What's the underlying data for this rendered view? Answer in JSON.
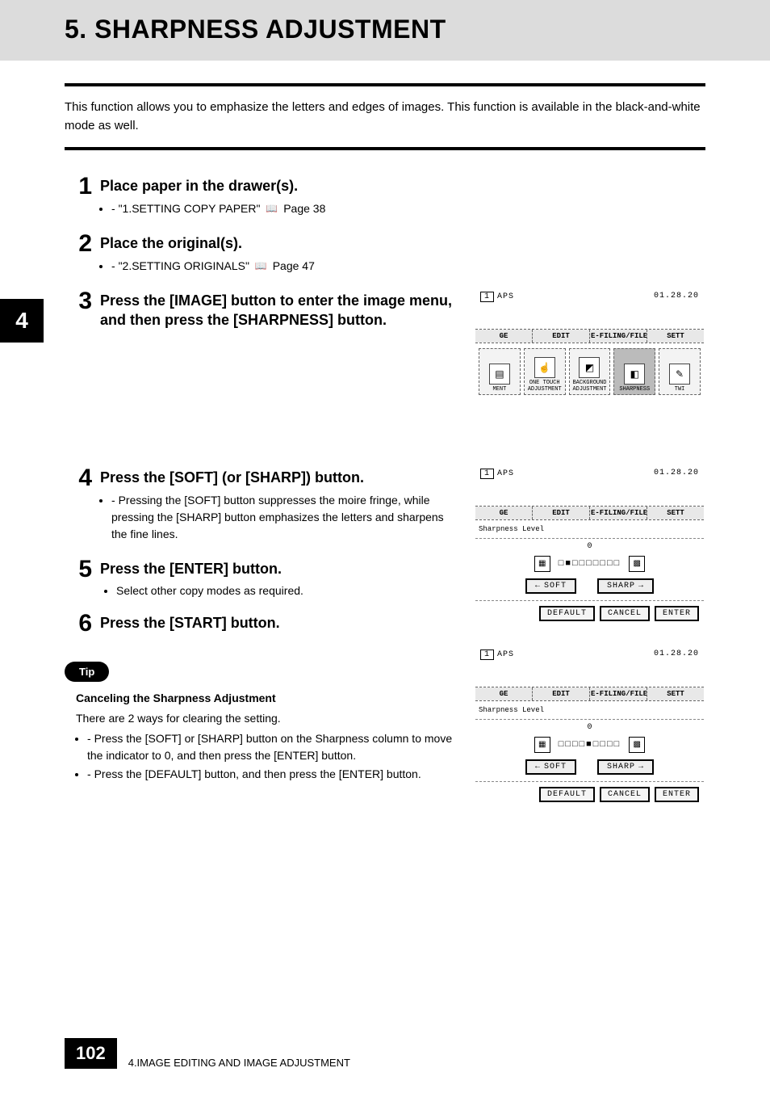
{
  "header": {
    "title": "5. SHARPNESS ADJUSTMENT"
  },
  "intro": "This function allows you to emphasize the letters and edges of images. This function is available in the black-and-white mode as well.",
  "side_tab": "4",
  "steps": {
    "s1": {
      "num": "1",
      "title": "Place paper in the drawer(s).",
      "ref": "\"1.SETTING COPY PAPER\"",
      "page": "Page 38"
    },
    "s2": {
      "num": "2",
      "title": "Place the original(s).",
      "ref": "\"2.SETTING ORIGINALS\"",
      "page": "Page 47"
    },
    "s3": {
      "num": "3",
      "title": "Press the [IMAGE] button to enter the image menu, and then press the [SHARPNESS] button."
    },
    "s4": {
      "num": "4",
      "title": "Press the [SOFT] (or [SHARP]) button.",
      "note": "Pressing the [SOFT] button suppresses the moire fringe, while pressing the [SHARP] button emphasizes the letters and sharpens the fine lines."
    },
    "s5": {
      "num": "5",
      "title": "Press the [ENTER] button.",
      "bullet": "Select other copy modes as required."
    },
    "s6": {
      "num": "6",
      "title": "Press the [START] button."
    }
  },
  "tip": {
    "badge": "Tip",
    "title": "Canceling the Sharpness Adjustment",
    "lead": "There are 2 ways for clearing the setting.",
    "items": [
      "Press the [SOFT] or [SHARP] button on the Sharpness column to move the indicator to 0, and then press the [ENTER] button.",
      "Press the [DEFAULT] button, and then press the [ENTER] button."
    ]
  },
  "panels": {
    "common": {
      "num": "1",
      "aps": "APS",
      "date": "01.28.20",
      "tabs": {
        "ge": "GE",
        "edit": "EDIT",
        "efile": "E-FILING/FILE",
        "sett": "SETT"
      }
    },
    "p1": {
      "btn_ment": "MENT",
      "btn_onetouch": "ONE TOUCH ADJUSTMENT",
      "btn_bg": "BACKGROUND ADJUSTMENT",
      "btn_sharp": "SHARPNESS",
      "btn_twi": "TWI"
    },
    "slider": {
      "label": "Sharpness Level",
      "zero": "0",
      "bar1": "□■□□□□□□□",
      "bar2": "□□□□■□□□□",
      "soft": "SOFT",
      "sharp": "SHARP",
      "default": "DEFAULT",
      "cancel": "CANCEL",
      "enter": "ENTER"
    }
  },
  "footer": {
    "page": "102",
    "chapter": "4.IMAGE EDITING AND IMAGE ADJUSTMENT"
  }
}
